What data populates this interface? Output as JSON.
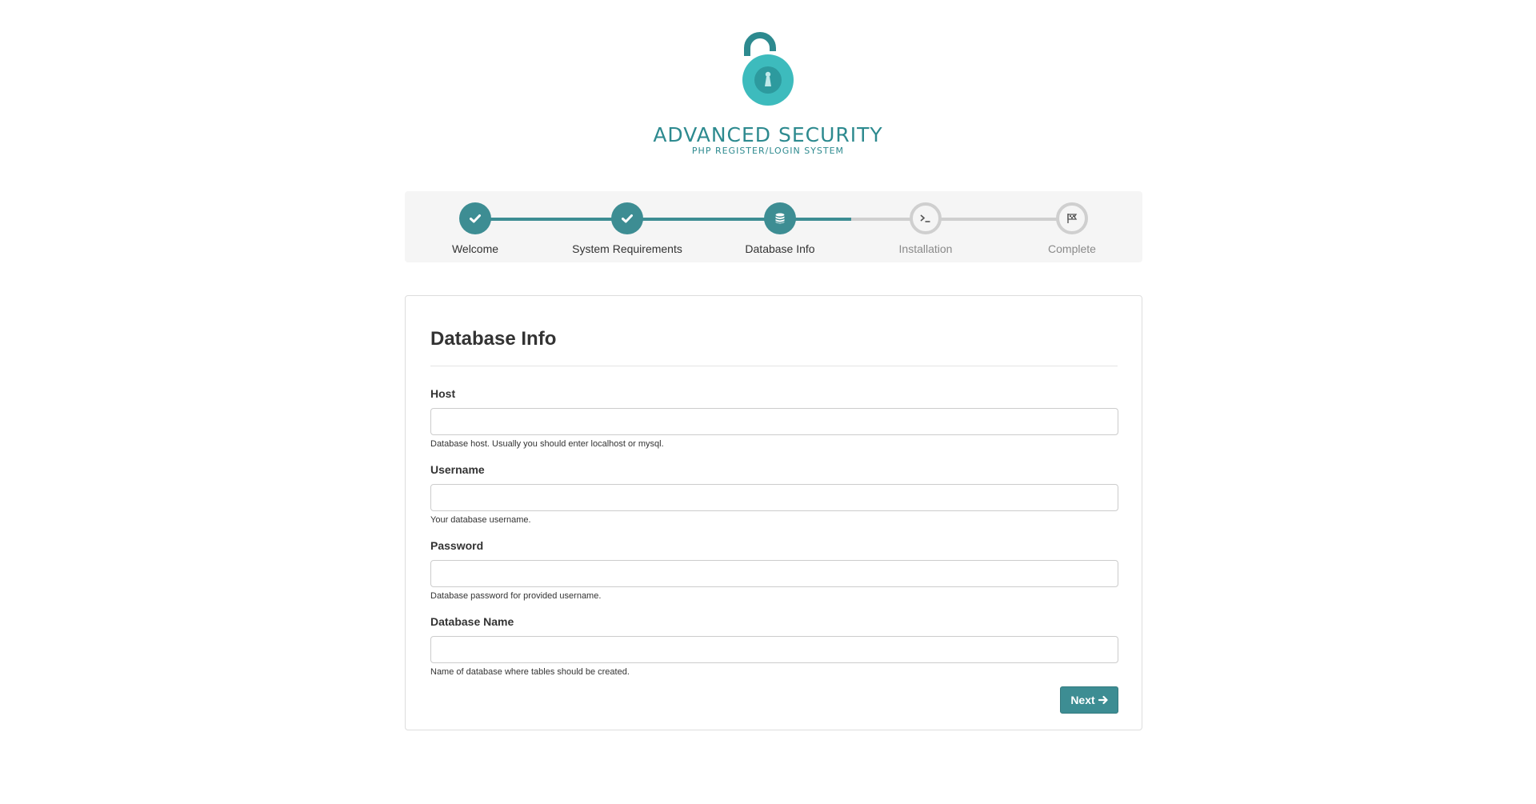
{
  "brand": {
    "title": "ADVANCED SECURITY",
    "subtitle": "PHP REGISTER/LOGIN SYSTEM",
    "logo_icon": "padlock-open-icon",
    "color": "#2d8a8f"
  },
  "steps": [
    {
      "label": "Welcome",
      "icon": "check-icon",
      "status": "done"
    },
    {
      "label": "System Requirements",
      "icon": "check-icon",
      "status": "done"
    },
    {
      "label": "Database Info",
      "icon": "database-icon",
      "status": "current"
    },
    {
      "label": "Installation",
      "icon": "terminal-icon",
      "status": "pending"
    },
    {
      "label": "Complete",
      "icon": "flag-icon",
      "status": "pending"
    }
  ],
  "form": {
    "title": "Database Info",
    "fields": [
      {
        "label": "Host",
        "value": "",
        "placeholder": "",
        "help": "Database host. Usually you should enter localhost or mysql."
      },
      {
        "label": "Username",
        "value": "",
        "placeholder": "",
        "help": "Your database username."
      },
      {
        "label": "Password",
        "value": "",
        "placeholder": "",
        "help": "Database password for provided username."
      },
      {
        "label": "Database Name",
        "value": "",
        "placeholder": "",
        "help": "Name of database where tables should be created."
      }
    ],
    "next_label": "Next",
    "next_icon": "arrow-right-icon"
  },
  "colors": {
    "accent": "#3d8d93",
    "pending": "#cfcfcf",
    "panel_bg": "#f5f5f5"
  }
}
